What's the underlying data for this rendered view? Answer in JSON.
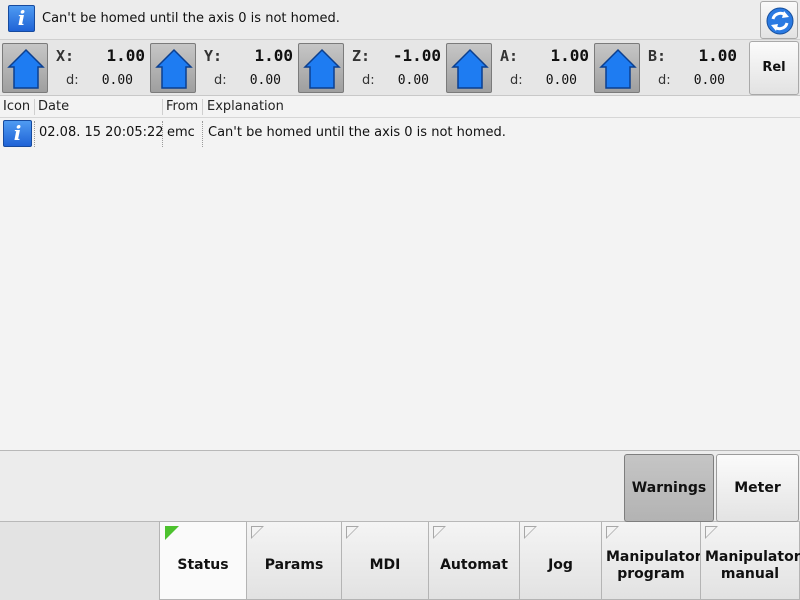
{
  "info_bar": {
    "icon": "info-icon",
    "icon_glyph": "i",
    "message": "Can't be homed until the axis 0 is not homed.",
    "refresh_icon": "refresh-icon"
  },
  "axes": [
    {
      "name": "X:",
      "value": "1.00",
      "d_label": "d:",
      "d_value": "0.00",
      "icon": "home-icon"
    },
    {
      "name": "Y:",
      "value": "1.00",
      "d_label": "d:",
      "d_value": "0.00",
      "icon": "home-icon"
    },
    {
      "name": "Z:",
      "value": "-1.00",
      "d_label": "d:",
      "d_value": "0.00",
      "icon": "home-icon"
    },
    {
      "name": "A:",
      "value": "1.00",
      "d_label": "d:",
      "d_value": "0.00",
      "icon": "home-icon"
    },
    {
      "name": "B:",
      "value": "1.00",
      "d_label": "d:",
      "d_value": "0.00",
      "icon": "home-icon"
    }
  ],
  "rel_button": "Rel",
  "log_table": {
    "columns": [
      "Icon",
      "Date",
      "From",
      "Explanation"
    ],
    "rows": [
      {
        "icon": "info-icon",
        "icon_glyph": "i",
        "date": "02.08. 15 20:05:22",
        "from": "emc",
        "explanation": "Can't be homed until the axis 0 is not homed."
      }
    ]
  },
  "side_buttons": {
    "warnings": "Warnings",
    "meter": "Meter"
  },
  "tabs": [
    {
      "label": "Status",
      "active": true
    },
    {
      "label": "Params",
      "active": false
    },
    {
      "label": "MDI",
      "active": false
    },
    {
      "label": "Automat",
      "active": false
    },
    {
      "label": "Jog",
      "active": false
    },
    {
      "label": "Manipulator program",
      "active": false
    },
    {
      "label": "Manipulator manual",
      "active": false
    }
  ],
  "colors": {
    "info_blue": "#2f7de8",
    "home_blue": "#1e7cf2",
    "active_tab_marker": "#4dc22e"
  }
}
